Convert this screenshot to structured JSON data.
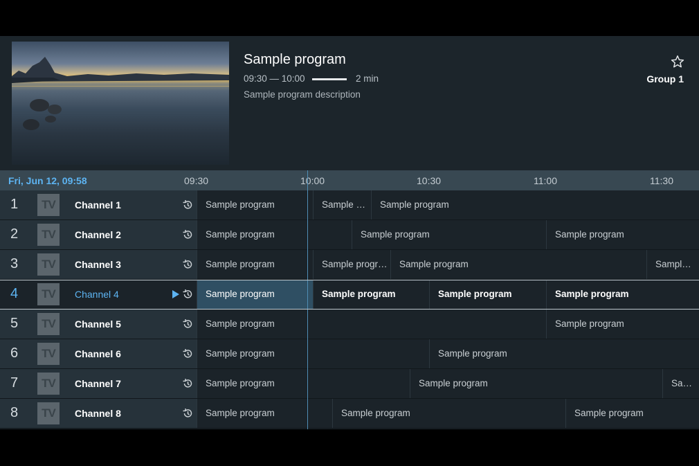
{
  "header": {
    "program_title": "Sample program",
    "time_range": "09:30 — 10:00",
    "progress_fraction": 1.0,
    "remaining": "2 min",
    "description": "Sample program description",
    "group": "Group 1"
  },
  "timeline": {
    "current_datetime": "Fri, Jun 12, 09:58",
    "ticks": [
      "09:30",
      "10:00",
      "10:30",
      "11:00",
      "11:30"
    ]
  },
  "channels": [
    {
      "number": "1",
      "logo": "TV",
      "name": "Channel 1",
      "programs": [
        "Sample program",
        "Sample …",
        "Sample program"
      ]
    },
    {
      "number": "2",
      "logo": "TV",
      "name": "Channel 2",
      "programs": [
        "Sample program",
        "Sample program",
        "Sample program"
      ]
    },
    {
      "number": "3",
      "logo": "TV",
      "name": "Channel 3",
      "programs": [
        "Sample program",
        "Sample progr…",
        "Sample program",
        "Sample program"
      ]
    },
    {
      "number": "4",
      "logo": "TV",
      "name": "Channel 4",
      "programs": [
        "Sample program",
        "Sample program",
        "Sample program",
        "Sample program"
      ]
    },
    {
      "number": "5",
      "logo": "TV",
      "name": "Channel 5",
      "programs": [
        "Sample program",
        "Sample program"
      ]
    },
    {
      "number": "6",
      "logo": "TV",
      "name": "Channel 6",
      "programs": [
        "Sample program",
        "Sample program"
      ]
    },
    {
      "number": "7",
      "logo": "TV",
      "name": "Channel 7",
      "programs": [
        "Sample program",
        "Sample program",
        "Sample program"
      ]
    },
    {
      "number": "8",
      "logo": "TV",
      "name": "Channel 8",
      "programs": [
        "Sample program",
        "Sample program",
        "Sample program"
      ]
    }
  ],
  "selected_channel_index": 3,
  "icons": {
    "star": "star-outline-icon",
    "history": "history-icon",
    "play": "play-icon"
  },
  "colors": {
    "accent": "#5db4f2",
    "now_line": "#4f8db5"
  }
}
